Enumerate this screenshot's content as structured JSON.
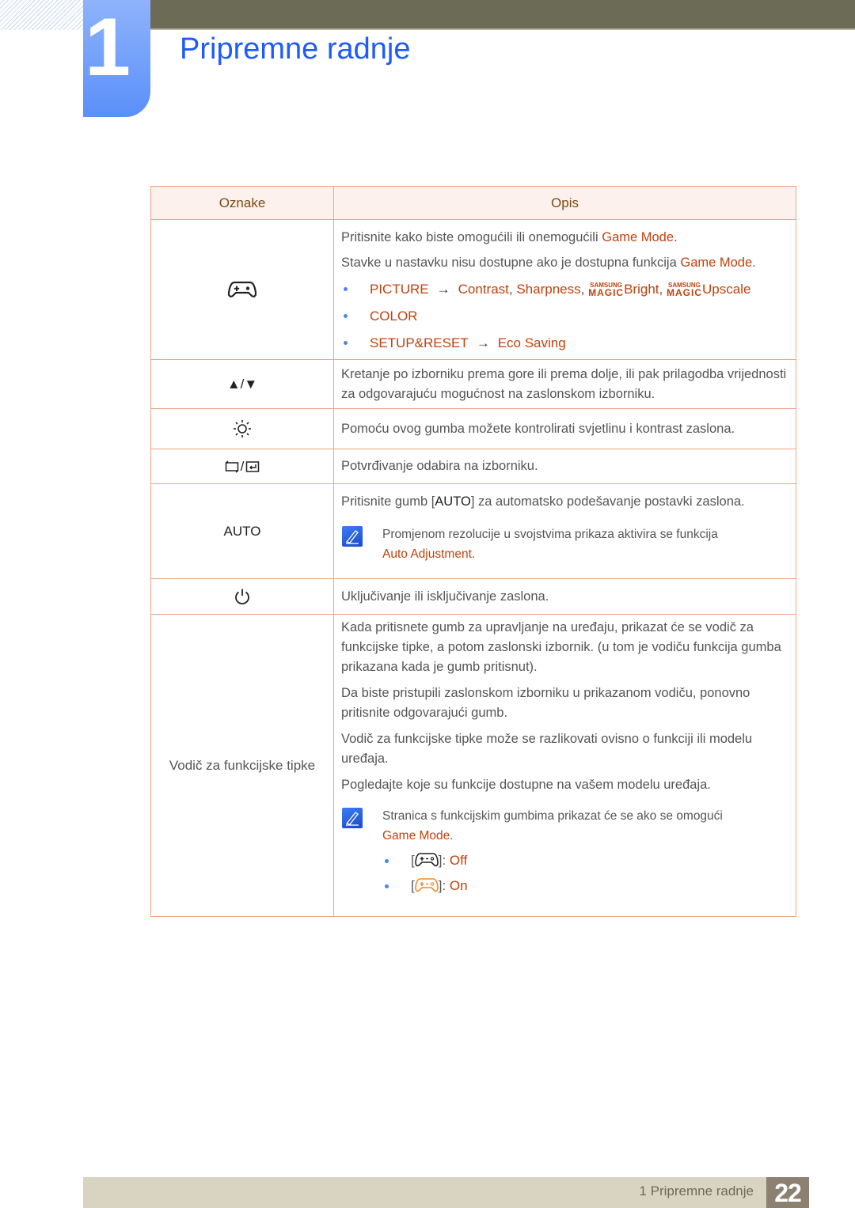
{
  "chapter": {
    "number": "1",
    "title": "Pripremne radnje"
  },
  "table": {
    "headers": {
      "label": "Oznake",
      "description": "Opis"
    },
    "game_mode_row": {
      "icon": "gamepad-icon",
      "line1_pre": "Pritisnite kako biste omogućili ili onemogućili ",
      "line1_hl": "Game Mode",
      "line2_pre": "Stavke u nastavku nisu dostupne ako je dostupna funkcija ",
      "line2_hl": "Game Mode",
      "period": ".",
      "bullets": {
        "picture": "PICTURE",
        "arrow": "→",
        "contrast": "Contrast",
        "sharpness": "Sharpness",
        "magic_top": "SAMSUNG",
        "magic_bottom": "MAGIC",
        "bright": "Bright",
        "upscale": "Upscale",
        "color": "COLOR",
        "setup": "SETUP&RESET",
        "eco": "Eco Saving",
        "comma": ","
      }
    },
    "updown_row": {
      "label": "▲/▼",
      "text": "Kretanje po izborniku prema gore ili prema dolje, ili pak prilagodba vrijednosti za odgovarajuću mogućnost na zaslonskom izborniku."
    },
    "brightness_row": {
      "icon": "sun-brightness-icon",
      "text": "Pomoću ovog gumba možete kontrolirati svjetlinu i kontrast zaslona."
    },
    "enter_row": {
      "icon": "source-enter-icon",
      "separator": "/",
      "text": "Potvrđivanje odabira na izborniku."
    },
    "auto_row": {
      "label": "AUTO",
      "text_pre": "Pritisnite gumb [",
      "text_key": "AUTO",
      "text_post": "] za automatsko podešavanje postavki zaslona.",
      "note_text": "Promjenom rezolucije u svojstvima prikaza aktivira se funkcija ",
      "note_hl": "Auto Adjustment",
      "period": "."
    },
    "power_row": {
      "icon": "power-icon",
      "text": "Uključivanje ili isključivanje zaslona."
    },
    "guide_row": {
      "label": "Vodič za funkcijske tipke",
      "p1": "Kada pritisnete gumb za upravljanje na uređaju, prikazat će se vodič za funkcijske tipke, a potom zaslonski izbornik. (u tom je vodiču funkcija gumba prikazana kada je gumb pritisnut).",
      "p2": "Da biste pristupili zaslonskom izborniku u prikazanom vodiču, ponovno pritisnite odgovarajući gumb.",
      "p3": "Vodič za funkcijske tipke može se razlikovati ovisno o funkciji ili modelu uređaja.",
      "p4": "Pogledajte koje su funkcije dostupne na vašem modelu uređaja.",
      "note_text": "Stranica s funkcijskim gumbima prikazat će se ako se omogući ",
      "note_hl": "Game Mode",
      "period": ".",
      "states": [
        {
          "icon": "gamepad-off-icon",
          "color": "#222222",
          "label": "Off"
        },
        {
          "icon": "gamepad-on-icon",
          "color": "#f08a24",
          "label": "On"
        }
      ],
      "bracket_open": "[",
      "bracket_close": "]:"
    }
  },
  "footer": {
    "text": "1 Pripremne radnje",
    "page": "22"
  }
}
